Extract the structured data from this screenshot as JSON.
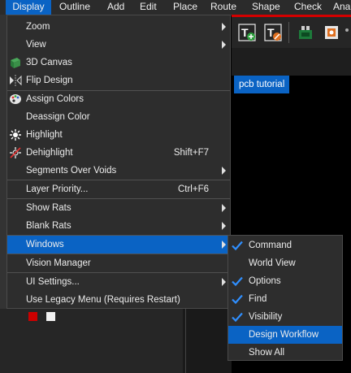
{
  "menubar": {
    "items": [
      {
        "label": "Display",
        "active": true
      },
      {
        "label": "Outline"
      },
      {
        "label": "Add"
      },
      {
        "label": "Edit"
      },
      {
        "label": "Place"
      },
      {
        "label": "Route"
      },
      {
        "label": "Shape"
      },
      {
        "label": "Check"
      },
      {
        "label": "Ana"
      }
    ]
  },
  "toolbar": {
    "icons": [
      "text-add-icon",
      "text-edit-icon",
      "component-icon",
      "chip-gear-icon"
    ]
  },
  "tab": {
    "label": "pcb tutorial"
  },
  "display_menu": {
    "items": [
      {
        "label": "Zoom",
        "submenu": true,
        "icon": "none"
      },
      {
        "label": "View",
        "submenu": true,
        "icon": "none"
      },
      {
        "label": "3D Canvas",
        "icon": "board-3d-icon"
      },
      {
        "label": "Flip Design",
        "icon": "flip-icon"
      },
      {
        "label": "Assign Colors",
        "icon": "palette-icon"
      },
      {
        "label": "Deassign Color",
        "icon": "none"
      },
      {
        "label": "Highlight",
        "icon": "highlight-icon"
      },
      {
        "label": "Dehighlight",
        "shortcut": "Shift+F7",
        "icon": "dehighlight-icon"
      },
      {
        "label": "Segments Over Voids",
        "submenu": true
      },
      {
        "label": "Layer Priority...",
        "shortcut": "Ctrl+F6"
      },
      {
        "label": "Show Rats",
        "submenu": true
      },
      {
        "label": "Blank Rats",
        "submenu": true
      },
      {
        "label": "Windows",
        "submenu": true,
        "selected": true
      },
      {
        "label": "Vision Manager"
      },
      {
        "label": "UI Settings...",
        "submenu": true
      },
      {
        "label": "Use Legacy Menu (Requires Restart)"
      }
    ]
  },
  "windows_submenu": {
    "items": [
      {
        "label": "Command",
        "checked": true
      },
      {
        "label": "World View",
        "checked": false
      },
      {
        "label": "Options",
        "checked": true
      },
      {
        "label": "Find",
        "checked": true
      },
      {
        "label": "Visibility",
        "checked": true
      },
      {
        "label": "Design Workflow",
        "checked": false,
        "selected": true
      },
      {
        "label": "Show All",
        "checked": false
      }
    ]
  },
  "colors": {
    "accent": "#0a63c4",
    "menu_bg": "#2d2d2d",
    "swatch_red": "#cc0000"
  }
}
